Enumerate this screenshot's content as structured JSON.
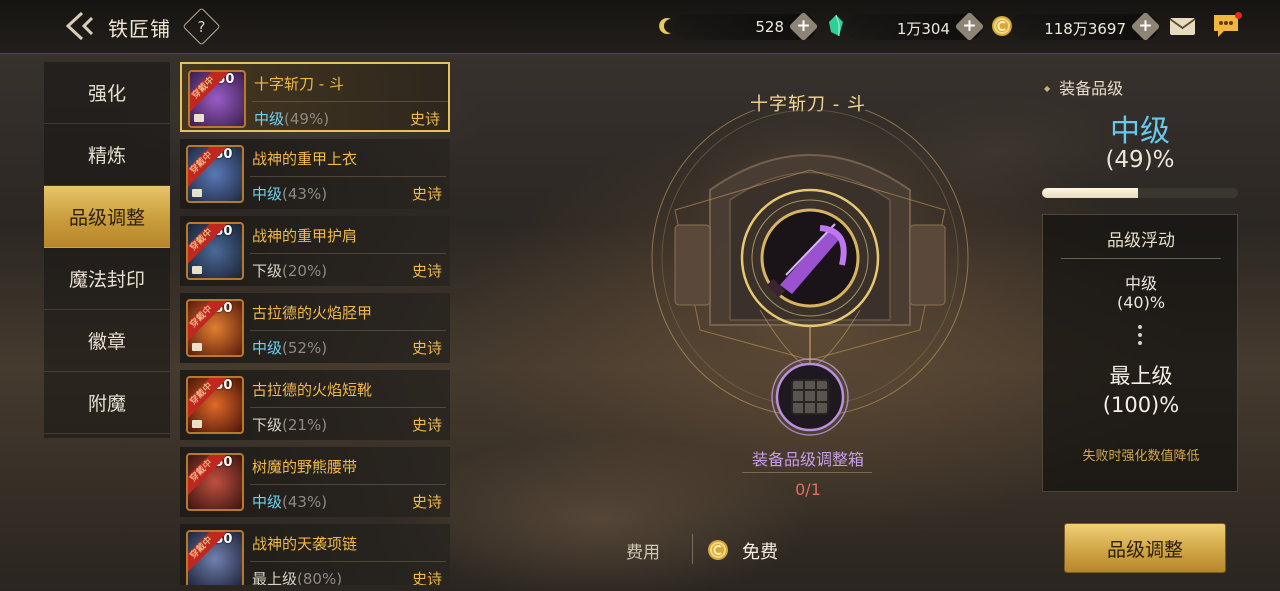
{
  "header": {
    "title": "铁匠铺",
    "help_label": "?",
    "currencies": [
      {
        "icon": "moon-currency-icon",
        "value": "528"
      },
      {
        "icon": "crystal-currency-icon",
        "value": "1万304"
      },
      {
        "icon": "gold-coin-icon",
        "value": "118万3697"
      }
    ],
    "plus_label": "+"
  },
  "nav": {
    "items": [
      {
        "label": "强化",
        "active": false
      },
      {
        "label": "精炼",
        "active": false
      },
      {
        "label": "品级调整",
        "active": true
      },
      {
        "label": "魔法封印",
        "active": false
      },
      {
        "label": "徽章",
        "active": false
      },
      {
        "label": "附魔",
        "active": false
      }
    ]
  },
  "equipment": {
    "ribbon": "穿戴中",
    "items": [
      {
        "level": "50",
        "name": "十字斩刀 - 斗",
        "grade": "中级",
        "percent": "(49%)",
        "rarity": "史诗",
        "selected": true
      },
      {
        "level": "50",
        "name": "战神的重甲上衣",
        "grade": "中级",
        "percent": "(43%)",
        "rarity": "史诗"
      },
      {
        "level": "50",
        "name": "战神的重甲护肩",
        "grade": "下级",
        "percent": "(20%)",
        "rarity": "史诗"
      },
      {
        "level": "50",
        "name": "古拉德的火焰胫甲",
        "grade": "中级",
        "percent": "(52%)",
        "rarity": "史诗"
      },
      {
        "level": "50",
        "name": "古拉德的火焰短靴",
        "grade": "下级",
        "percent": "(21%)",
        "rarity": "史诗"
      },
      {
        "level": "50",
        "name": "树魔的野熊腰带",
        "grade": "中级",
        "percent": "(43%)",
        "rarity": "史诗"
      },
      {
        "level": "50",
        "name": "战神的天袭项链",
        "grade": "最上级",
        "percent": "(80%)",
        "rarity": "史诗"
      }
    ]
  },
  "center": {
    "item_title": "十字斩刀 - 斗",
    "material_label": "装备品级调整箱",
    "material_count": "0/1"
  },
  "cost": {
    "label": "费用",
    "value": "免费"
  },
  "action": {
    "label": "品级调整"
  },
  "grade_panel": {
    "title": "装备品级",
    "current_grade": "中级",
    "current_percent": "(49)%",
    "progress": 0.49,
    "range_title": "品级浮动",
    "min_grade": "中级",
    "min_percent": "(40)%",
    "max_grade": "最上级",
    "max_percent": "(100)%",
    "warning": "失败时强化数值降低"
  },
  "colors": {
    "gold_accent": "#e7c25c",
    "grade_blue": "#66c9ee",
    "rarity_orange": "#f0b94a",
    "material_purple": "#c79ce6",
    "count_red": "#e07060"
  }
}
